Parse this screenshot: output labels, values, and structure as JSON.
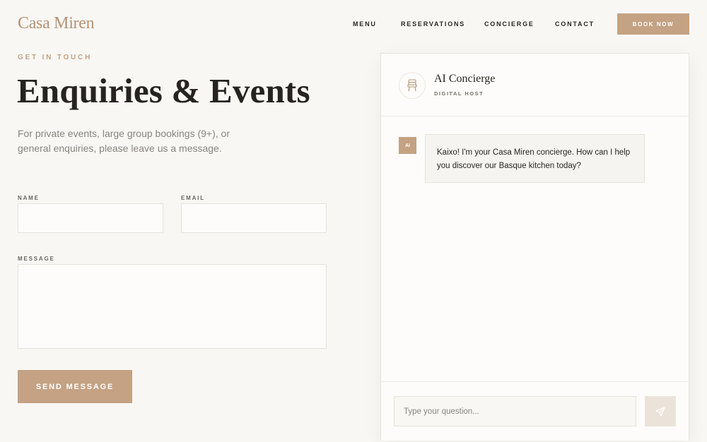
{
  "brand": {
    "name": "Casa Miren"
  },
  "nav": {
    "items": [
      "MENU",
      "RESERVATIONS",
      "CONCIERGE",
      "CONTACT"
    ],
    "cta": "BOOK NOW"
  },
  "contact": {
    "eyebrow": "GET IN TOUCH",
    "title": "Enquiries & Events",
    "intro": "For private events, large group bookings (9+), or general enquiries, please leave us a message.",
    "name_label": "NAME",
    "email_label": "EMAIL",
    "message_label": "MESSAGE",
    "name_value": "",
    "email_value": "",
    "message_value": "",
    "submit": "SEND MESSAGE"
  },
  "chat": {
    "title": "AI Concierge",
    "subtitle": "DIGITAL HOST",
    "avatar_icon": "chair-icon",
    "messages": [
      {
        "sender": "AI",
        "text": "Kaixo! I'm your Casa Miren concierge. How can I help you discover our Basque kitchen today?"
      }
    ],
    "input_placeholder": "Type your question...",
    "send_icon": "send-icon"
  },
  "colors": {
    "accent": "#c4a283",
    "logo": "#b59273",
    "background": "#f8f7f4",
    "text": "#2a2622",
    "muted": "#8a847d",
    "send_button_bg": "#ebe3d9"
  }
}
